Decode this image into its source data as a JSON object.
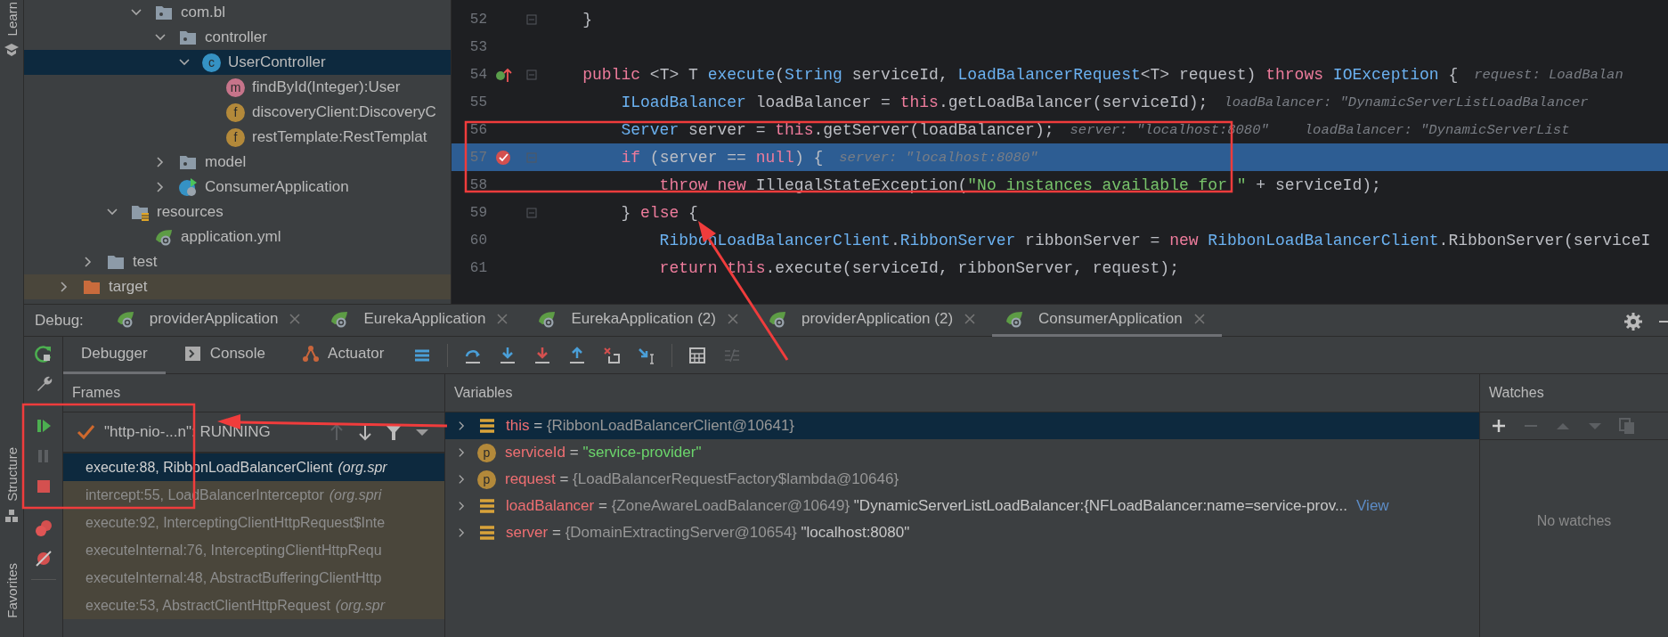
{
  "side_strip": [
    {
      "label": "Learn",
      "kind": "learn"
    },
    {
      "label": "Structure",
      "kind": "structure"
    },
    {
      "label": "Favorites",
      "kind": "favorites"
    }
  ],
  "project_tree": {
    "items": [
      {
        "label": "com.bl",
        "kind": "package",
        "expanded": true,
        "selected": false,
        "children": [
          {
            "label": "controller",
            "kind": "package",
            "expanded": true,
            "selected": false,
            "children": [
              {
                "label": "UserController",
                "kind": "class",
                "letter": "c",
                "expanded": true,
                "selected": true,
                "children": [
                  {
                    "label": "findById(Integer):User",
                    "kind": "method",
                    "letter": "m",
                    "selected": false
                  },
                  {
                    "label": "discoveryClient:DiscoveryC",
                    "kind": "field",
                    "letter": "f",
                    "selected": false
                  },
                  {
                    "label": "restTemplate:RestTemplat",
                    "kind": "field",
                    "letter": "f",
                    "selected": false
                  }
                ]
              }
            ]
          },
          {
            "label": "model",
            "kind": "package",
            "expanded": false,
            "selected": false
          },
          {
            "label": "ConsumerApplication",
            "kind": "spring-class",
            "expanded": false,
            "selected": false
          }
        ]
      },
      {
        "label": "resources",
        "kind": "resources",
        "expanded": true,
        "selected": false,
        "children": [
          {
            "label": "application.yml",
            "kind": "yml",
            "selected": false
          }
        ]
      },
      {
        "label": "test",
        "kind": "folder",
        "expanded": false,
        "selected": false
      },
      {
        "label": "target",
        "kind": "excluded-folder",
        "expanded": false,
        "selected": false
      }
    ]
  },
  "editor": {
    "lines": [
      {
        "number": "52",
        "fold": true,
        "current": false,
        "tokens": [
          {
            "kind": "plain",
            "text": "    }"
          }
        ]
      },
      {
        "number": "53",
        "fold": false,
        "current": false
      },
      {
        "number": "54",
        "fold": true,
        "current": false,
        "gutter": {
          "kind": "override"
        },
        "tokens": [
          {
            "kind": "keyword",
            "text": "    public"
          },
          {
            "kind": "plain",
            "text": " <T> T "
          },
          {
            "kind": "function",
            "text": "execute"
          },
          {
            "kind": "plain",
            "text": "("
          },
          {
            "kind": "type",
            "text": "String"
          },
          {
            "kind": "plain",
            "text": " serviceId, "
          },
          {
            "kind": "type",
            "text": "LoadBalancerRequest"
          },
          {
            "kind": "plain",
            "text": "<T> request) "
          },
          {
            "kind": "keyword",
            "text": "throws "
          },
          {
            "kind": "type",
            "text": "IOException"
          },
          {
            "kind": "plain",
            "text": " {"
          }
        ],
        "hints": [
          "request: LoadBalan"
        ]
      },
      {
        "number": "55",
        "fold": false,
        "current": false,
        "tokens": [
          {
            "kind": "type",
            "text": "        ILoadBalancer"
          },
          {
            "kind": "plain",
            "text": " loadBalancer = "
          },
          {
            "kind": "keyword",
            "text": "this"
          },
          {
            "kind": "plain",
            "text": ".getLoadBalancer(serviceId);"
          }
        ],
        "hints": [
          "loadBalancer: \"DynamicServerListLoadBalancer"
        ]
      },
      {
        "number": "56",
        "fold": false,
        "current": false,
        "tokens": [
          {
            "kind": "type",
            "text": "        Server"
          },
          {
            "kind": "plain",
            "text": " server = "
          },
          {
            "kind": "keyword",
            "text": "this"
          },
          {
            "kind": "plain",
            "text": ".getServer(loadBalancer);"
          }
        ],
        "hints": [
          "server: \"localhost:8080\"",
          "loadBalancer: \"DynamicServerList"
        ]
      },
      {
        "number": "57",
        "fold": true,
        "current": true,
        "gutter": {
          "kind": "breakpoint"
        },
        "tokens": [
          {
            "kind": "keyword",
            "text": "        if"
          },
          {
            "kind": "plain",
            "text": " (server == "
          },
          {
            "kind": "keyword",
            "text": "null"
          },
          {
            "kind": "plain",
            "text": ") {"
          }
        ],
        "hints": [
          "server: \"localhost:8080\""
        ]
      },
      {
        "number": "58",
        "fold": false,
        "current": false,
        "tokens": [
          {
            "kind": "keyword",
            "text": "            throw new"
          },
          {
            "kind": "plain",
            "text": " IllegalStateException("
          },
          {
            "kind": "string",
            "text": "\"No instances available for \""
          },
          {
            "kind": "plain",
            "text": " + serviceId);"
          }
        ]
      },
      {
        "number": "59",
        "fold": true,
        "current": false,
        "tokens": [
          {
            "kind": "plain",
            "text": "        } "
          },
          {
            "kind": "keyword",
            "text": "else"
          },
          {
            "kind": "plain",
            "text": " {"
          }
        ]
      },
      {
        "number": "60",
        "fold": false,
        "current": false,
        "tokens": [
          {
            "kind": "type",
            "text": "            RibbonLoadBalancerClient"
          },
          {
            "kind": "plain",
            "text": "."
          },
          {
            "kind": "type",
            "text": "RibbonServer"
          },
          {
            "kind": "plain",
            "text": " ribbonServer = "
          },
          {
            "kind": "keyword",
            "text": "new "
          },
          {
            "kind": "type",
            "text": "RibbonLoadBalancerClient"
          },
          {
            "kind": "plain",
            "text": ".RibbonServer(serviceI"
          }
        ]
      },
      {
        "number": "61",
        "fold": false,
        "current": false,
        "tokens": [
          {
            "kind": "keyword",
            "text": "            return this"
          },
          {
            "kind": "plain",
            "text": ".execute(serviceId, ribbonServer, request);"
          }
        ]
      }
    ]
  },
  "debug": {
    "label": "Debug:",
    "tabs": [
      {
        "label": "providerApplication",
        "selected": false
      },
      {
        "label": "EurekaApplication",
        "selected": false
      },
      {
        "label": "EurekaApplication (2)",
        "selected": false
      },
      {
        "label": "providerApplication (2)",
        "selected": false
      },
      {
        "label": "ConsumerApplication",
        "selected": true
      }
    ],
    "views": [
      {
        "label": "Debugger",
        "kind": "debugger",
        "selected": true
      },
      {
        "label": "Console",
        "kind": "console",
        "selected": false
      },
      {
        "label": "Actuator",
        "kind": "actuator",
        "selected": false
      }
    ],
    "frames": {
      "title": "Frames",
      "thread": "\"http-nio-...n\": RUNNING",
      "rows": [
        {
          "text": "execute:88, RibbonLoadBalancerClient *(org.spr*",
          "selected": true
        },
        {
          "text": "intercept:55, LoadBalancerInterceptor *(org.spri*",
          "selected": false
        },
        {
          "text": "execute:92, InterceptingClientHttpRequest$Inte",
          "selected": false
        },
        {
          "text": "executeInternal:76, InterceptingClientHttpRequ",
          "selected": false
        },
        {
          "text": "executeInternal:48, AbstractBufferingClientHttp",
          "selected": false
        },
        {
          "text": "execute:53, AbstractClientHttpRequest *(org.spr*",
          "selected": false
        }
      ]
    },
    "variables": {
      "title": "Variables",
      "rows": [
        {
          "kind": "field",
          "name": "this",
          "operator": "=",
          "values": [
            {
              "kind": "ref",
              "text": "{RibbonLoadBalancerClient@10641}"
            }
          ],
          "selected": true
        },
        {
          "kind": "param",
          "letter": "p",
          "name": "serviceId",
          "operator": "=",
          "values": [
            {
              "kind": "string",
              "text": "\"service-provider\""
            }
          ],
          "selected": false
        },
        {
          "kind": "param",
          "letter": "p",
          "name": "request",
          "operator": "=",
          "values": [
            {
              "kind": "ref",
              "text": "{LoadBalancerRequestFactory$lambda@10646}"
            }
          ],
          "selected": false
        },
        {
          "kind": "field",
          "name": "loadBalancer",
          "operator": "=",
          "values": [
            {
              "kind": "ref",
              "text": "{ZoneAwareLoadBalancer@10649}"
            },
            {
              "kind": "text",
              "text": "\"DynamicServerListLoadBalancer:{NFLoadBalancer:name=service-prov..."
            }
          ],
          "link": "View",
          "selected": false
        },
        {
          "kind": "field",
          "name": "server",
          "operator": "=",
          "values": [
            {
              "kind": "ref",
              "text": "{DomainExtractingServer@10654}"
            },
            {
              "kind": "text",
              "text": "\"localhost:8080\""
            }
          ],
          "selected": false
        }
      ]
    },
    "watches": {
      "title": "Watches",
      "empty_text": "No watches"
    }
  }
}
